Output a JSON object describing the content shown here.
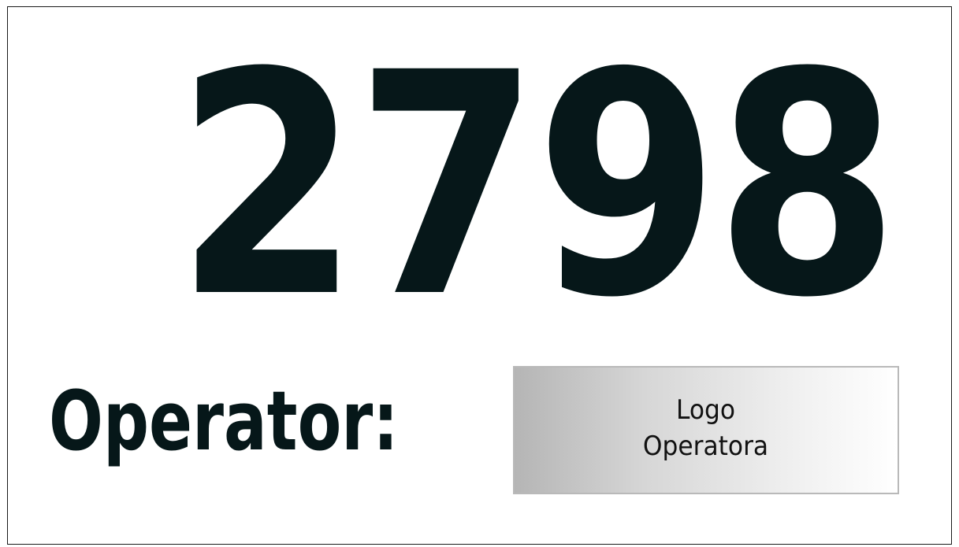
{
  "sign": {
    "number": "2798",
    "operator_label": "Operator:",
    "logo_placeholder": {
      "line1": "Logo",
      "line2": "Operatora"
    }
  },
  "colors": {
    "text": "#061719",
    "frame": "#1a1a1a",
    "logo_gradient_start": "#b5b5b5",
    "logo_gradient_end": "#ffffff"
  }
}
